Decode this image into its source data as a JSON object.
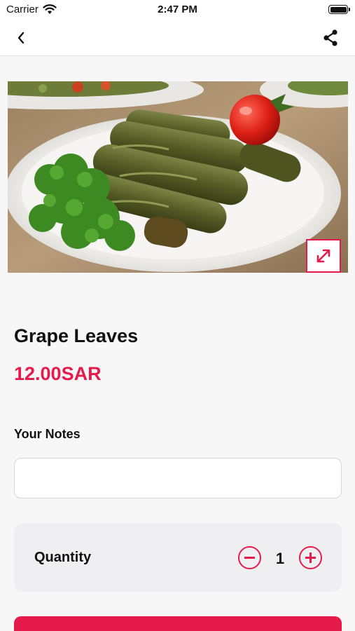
{
  "status_bar": {
    "carrier": "Carrier",
    "time": "2:47 PM"
  },
  "nav": {
    "back_icon": "chevron-left-icon",
    "share_icon": "share-icon"
  },
  "product": {
    "image_icon": "expand-icon",
    "title": "Grape Leaves",
    "price": "12.00SAR"
  },
  "notes": {
    "label": "Your Notes",
    "value": "",
    "placeholder": ""
  },
  "quantity": {
    "label": "Quantity",
    "value": "1",
    "minus_icon": "minus-circle-icon",
    "plus_icon": "plus-circle-icon"
  },
  "colors": {
    "accent": "#e51b4b",
    "background": "#f7f7f7",
    "card": "#efeff1"
  }
}
